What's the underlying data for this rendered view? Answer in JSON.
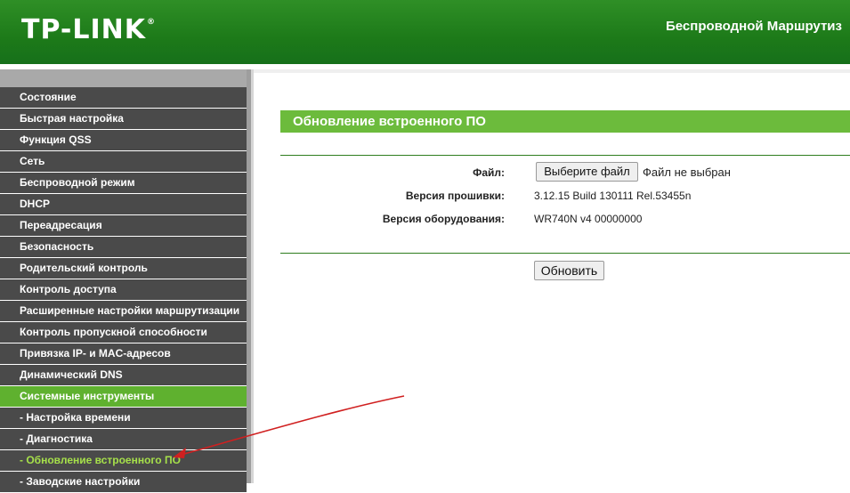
{
  "header": {
    "logo": "TP-LINK",
    "logo_mark": "®",
    "title": "Беспроводной Маршрутиз"
  },
  "menu": {
    "items": [
      {
        "label": "Состояние",
        "state": "normal"
      },
      {
        "label": "Быстрая настройка",
        "state": "normal"
      },
      {
        "label": "Функция QSS",
        "state": "normal"
      },
      {
        "label": "Сеть",
        "state": "normal"
      },
      {
        "label": "Беспроводной режим",
        "state": "normal"
      },
      {
        "label": "DHCP",
        "state": "normal"
      },
      {
        "label": "Переадресация",
        "state": "normal"
      },
      {
        "label": "Безопасность",
        "state": "normal"
      },
      {
        "label": "Родительский контроль",
        "state": "normal"
      },
      {
        "label": "Контроль доступа",
        "state": "normal"
      },
      {
        "label": "Расширенные настройки маршрутизации",
        "state": "normal"
      },
      {
        "label": "Контроль пропускной способности",
        "state": "normal"
      },
      {
        "label": "Привязка IP- и MAC-адресов",
        "state": "normal"
      },
      {
        "label": "Динамический DNS",
        "state": "normal"
      },
      {
        "label": "Системные инструменты",
        "state": "active"
      },
      {
        "label": "- Настройка времени",
        "state": "sub"
      },
      {
        "label": "- Диагностика",
        "state": "sub"
      },
      {
        "label": "- Обновление встроенного ПО",
        "state": "current"
      },
      {
        "label": "- Заводские настройки",
        "state": "sub"
      }
    ]
  },
  "main": {
    "section_title": "Обновление встроенного ПО",
    "file_label": "Файл:",
    "file_button": "Выберите файл",
    "file_status": "Файл не выбран",
    "firmware_label": "Версия прошивки:",
    "firmware_value": "3.12.15 Build 130111 Rel.53455n",
    "hardware_label": "Версия оборудования:",
    "hardware_value": "WR740N v4 00000000",
    "upgrade_button": "Обновить"
  },
  "colors": {
    "header_green": "#1d7a19",
    "menu_dark": "#4a4a4a",
    "menu_active": "#5fb12f",
    "current_text": "#a6e04a",
    "title_bar": "#6cbb3c",
    "arrow": "#d02020"
  }
}
